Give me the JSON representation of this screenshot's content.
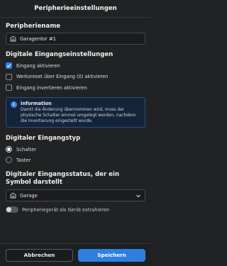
{
  "header": {
    "title": "Peripherieeinstellungen"
  },
  "peripheral_name": {
    "title": "Peripheriename",
    "value": "Garagentor #1",
    "icon": "garage-door-icon"
  },
  "digital_input": {
    "title": "Digitale Eingangseinstellungen",
    "options": [
      {
        "label": "Eingang aktivieren",
        "checked": true
      },
      {
        "label": "Werksreset über Eingang (0) aktivieren",
        "checked": false
      },
      {
        "label": "Eingang invertieren aktivieren",
        "checked": false
      }
    ]
  },
  "info": {
    "icon": "info-icon",
    "title": "Information",
    "text": "Damit die Änderung übernommen wird, muss der physische Schalter einmal umgelegt werden, nachdem die Invertierung eingestellt wurde."
  },
  "input_type": {
    "title": "Digitaler Eingangstyp",
    "options": [
      {
        "label": "Schalter",
        "selected": true
      },
      {
        "label": "Taster",
        "selected": false
      }
    ]
  },
  "input_status": {
    "title": "Digitaler Eingangsstatus, der ein Symbol darstellt",
    "selected": "Garage",
    "icon": "garage-door-icon"
  },
  "extract_toggle": {
    "label": "Peripheriegerät als Gerät extrahieren",
    "on": false
  },
  "footer": {
    "cancel_label": "Abbrechen",
    "save_label": "Speichern"
  },
  "colors": {
    "background": "#202224",
    "accent": "#2f7fe0",
    "info_bg": "#16243a"
  }
}
